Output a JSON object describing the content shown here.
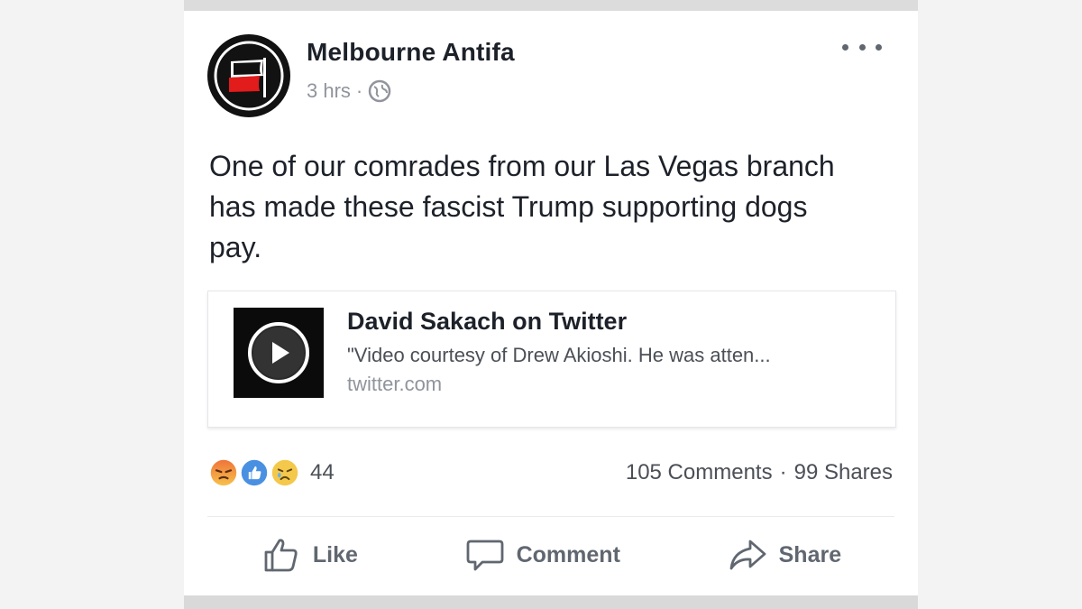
{
  "post": {
    "page_name": "Melbourne Antifa",
    "timestamp": "3 hrs",
    "separator": "·",
    "privacy_icon": "globe-icon",
    "text": "One of our comrades from our Las Vegas branch has made these fascist Trump supporting dogs pay."
  },
  "link_preview": {
    "title": "David Sakach on Twitter",
    "description": "\"Video courtesy of Drew Akioshi. He was atten...",
    "domain": "twitter.com",
    "thumbnail_icon": "play-icon"
  },
  "engagement": {
    "reaction_icons": [
      "angry-reaction-icon",
      "like-reaction-icon",
      "sad-reaction-icon"
    ],
    "reaction_count": "44",
    "comments": "105 Comments",
    "stats_separator": "·",
    "shares": "99 Shares"
  },
  "actions": {
    "like_label": "Like",
    "comment_label": "Comment",
    "share_label": "Share"
  },
  "colors": {
    "text_primary": "#1d2129",
    "text_secondary": "#90949c",
    "like_blue": "#4a90e2",
    "angry_orange": "#f0743a",
    "sad_yellow": "#f4c84a"
  }
}
